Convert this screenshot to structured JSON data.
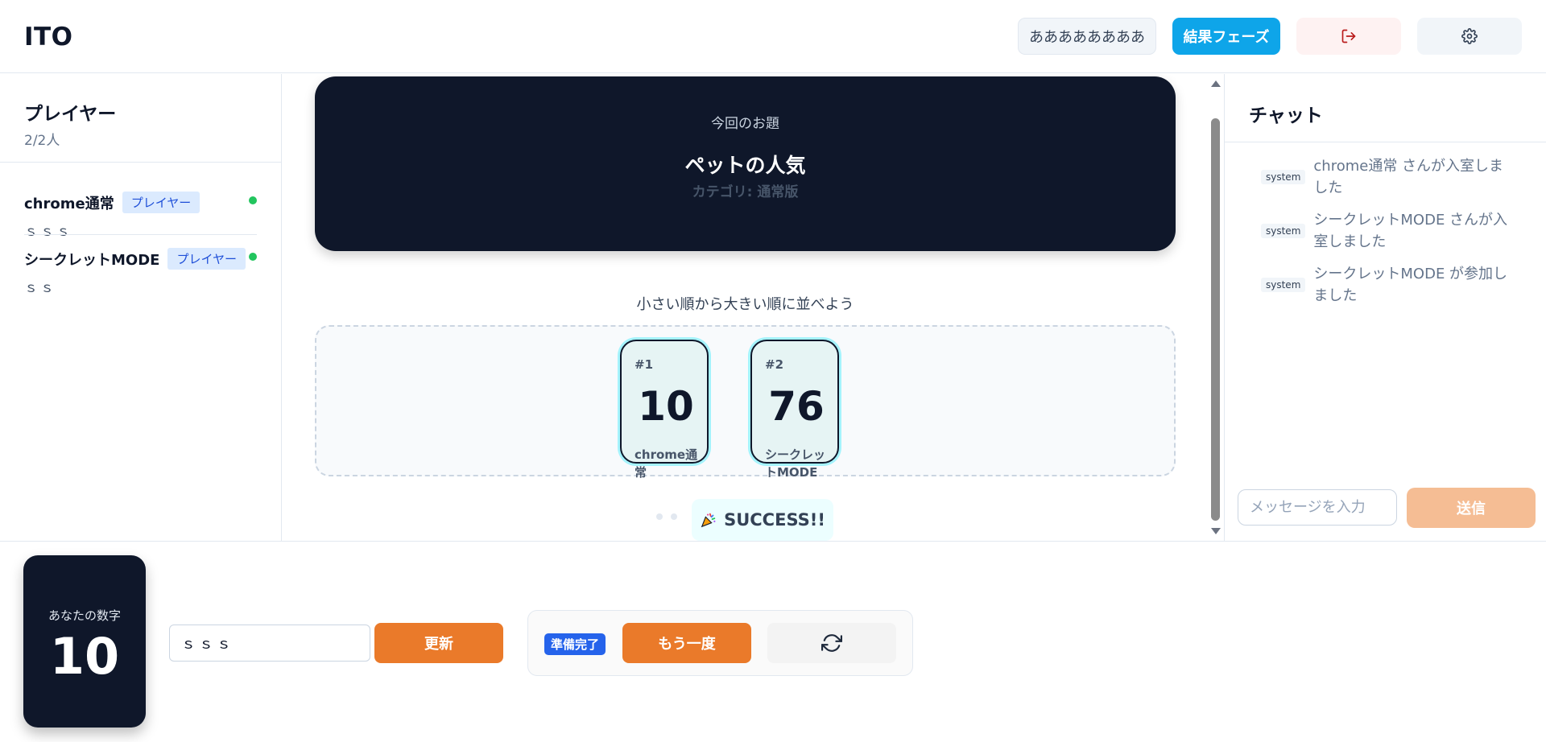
{
  "app": {
    "title": "ITO"
  },
  "header": {
    "room_name": "ああああああああ",
    "phase_label": "結果フェーズ",
    "exit_icon": "logout-icon",
    "settings_icon": "gear-icon"
  },
  "players_panel": {
    "title": "プレイヤー",
    "count": "2/2人",
    "players": [
      {
        "name": "chrome通常",
        "role": "プレイヤー",
        "hint": "ｓｓｓ",
        "online": true
      },
      {
        "name": "シークレットMODE",
        "role": "プレイヤー",
        "hint": "ｓｓ",
        "online": true
      }
    ]
  },
  "topic": {
    "label": "今回のお題",
    "title": "ペットの人気",
    "category": "カテゴリ: 通常版"
  },
  "board": {
    "instruction": "小さい順から大きい順に並べよう",
    "cards": [
      {
        "index": "#1",
        "number": "10",
        "player": "chrome通常"
      },
      {
        "index": "#2",
        "number": "76",
        "player": "シークレットMODE"
      }
    ],
    "result": "SUCCESS!!",
    "result_icon": "party-popper-icon"
  },
  "chat": {
    "title": "チャット",
    "messages": [
      {
        "tag": "system",
        "text": "chrome通常 さんが入室しました"
      },
      {
        "tag": "system",
        "text": "シークレットMODE さんが入室しました"
      },
      {
        "tag": "system",
        "text": "シークレットMODE が参加しました"
      }
    ],
    "input_placeholder": "メッセージを入力",
    "input_value": "",
    "send_label": "送信"
  },
  "bottom": {
    "my_number_label": "あなたの数字",
    "my_number": "10",
    "hint_value": "ｓｓｓ",
    "update_label": "更新",
    "ready_badge": "準備完了",
    "again_label": "もう一度",
    "reload_icon": "refresh-icon"
  },
  "colors": {
    "accent_orange": "#ea7a2a",
    "primary_blue": "#0ea5e9",
    "dark_card": "#0f172a",
    "online_green": "#22c55e"
  }
}
